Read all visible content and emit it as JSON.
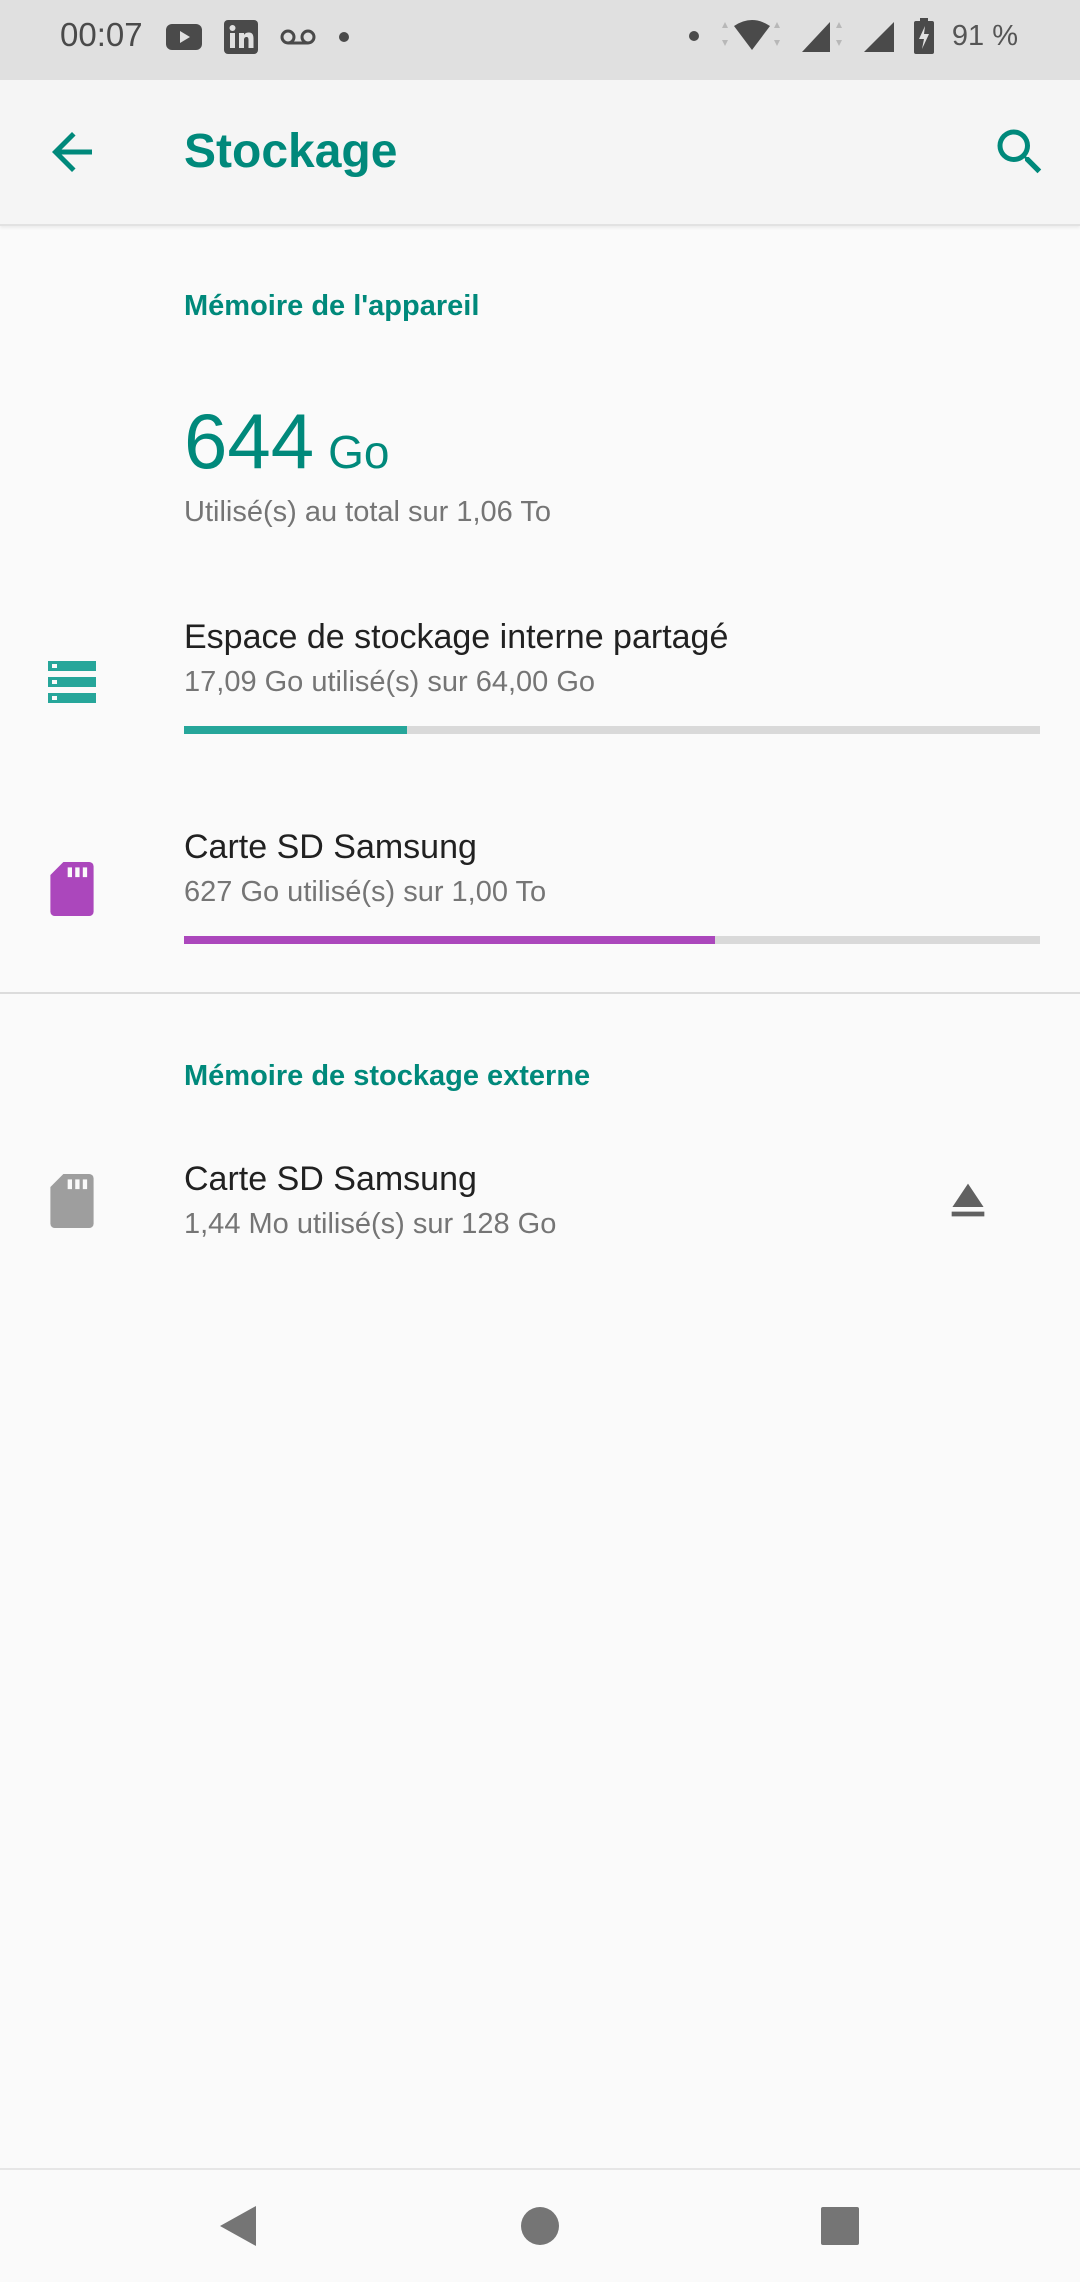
{
  "status_bar": {
    "time": "00:07",
    "battery_text": "91 %",
    "left_icons": [
      "youtube-icon",
      "linkedin-icon",
      "voicemail-icon",
      "dot-icon"
    ],
    "right_icons": [
      "dot-icon",
      "data-arrows-icon",
      "wifi-icon",
      "signal-icon",
      "signal-icon",
      "battery-charging-icon"
    ]
  },
  "app_bar": {
    "title": "Stockage",
    "back_icon": "arrow-back-icon",
    "search_icon": "search-icon"
  },
  "device_memory": {
    "header": "Mémoire de l'appareil",
    "total_value": "644",
    "total_unit": "Go",
    "total_caption": "Utilisé(s) au total sur 1,06 To",
    "items": [
      {
        "title": "Espace de stockage interne partagé",
        "subtitle": "17,09 Go utilisé(s) sur 64,00 Go",
        "icon": "storage-icon",
        "color": "#26a69a",
        "progress": 0.26
      },
      {
        "title": "Carte SD Samsung",
        "subtitle": "627 Go utilisé(s) sur 1,00 To",
        "icon": "sd-card-icon",
        "color": "#ab47bc",
        "progress": 0.62
      }
    ]
  },
  "external_memory": {
    "header": "Mémoire de stockage externe",
    "items": [
      {
        "title": "Carte SD Samsung",
        "subtitle": "1,44 Mo utilisé(s) sur 128 Go",
        "icon": "sd-card-icon",
        "color": "#9e9e9e",
        "action_icon": "eject-icon"
      }
    ]
  },
  "nav_bar": {
    "buttons": [
      "back-triangle-icon",
      "home-circle-icon",
      "recents-square-icon"
    ]
  },
  "colors": {
    "accent": "#00897b",
    "teal_bar": "#26a69a",
    "purple_bar": "#ab47bc",
    "track": "#d9d9d9"
  }
}
